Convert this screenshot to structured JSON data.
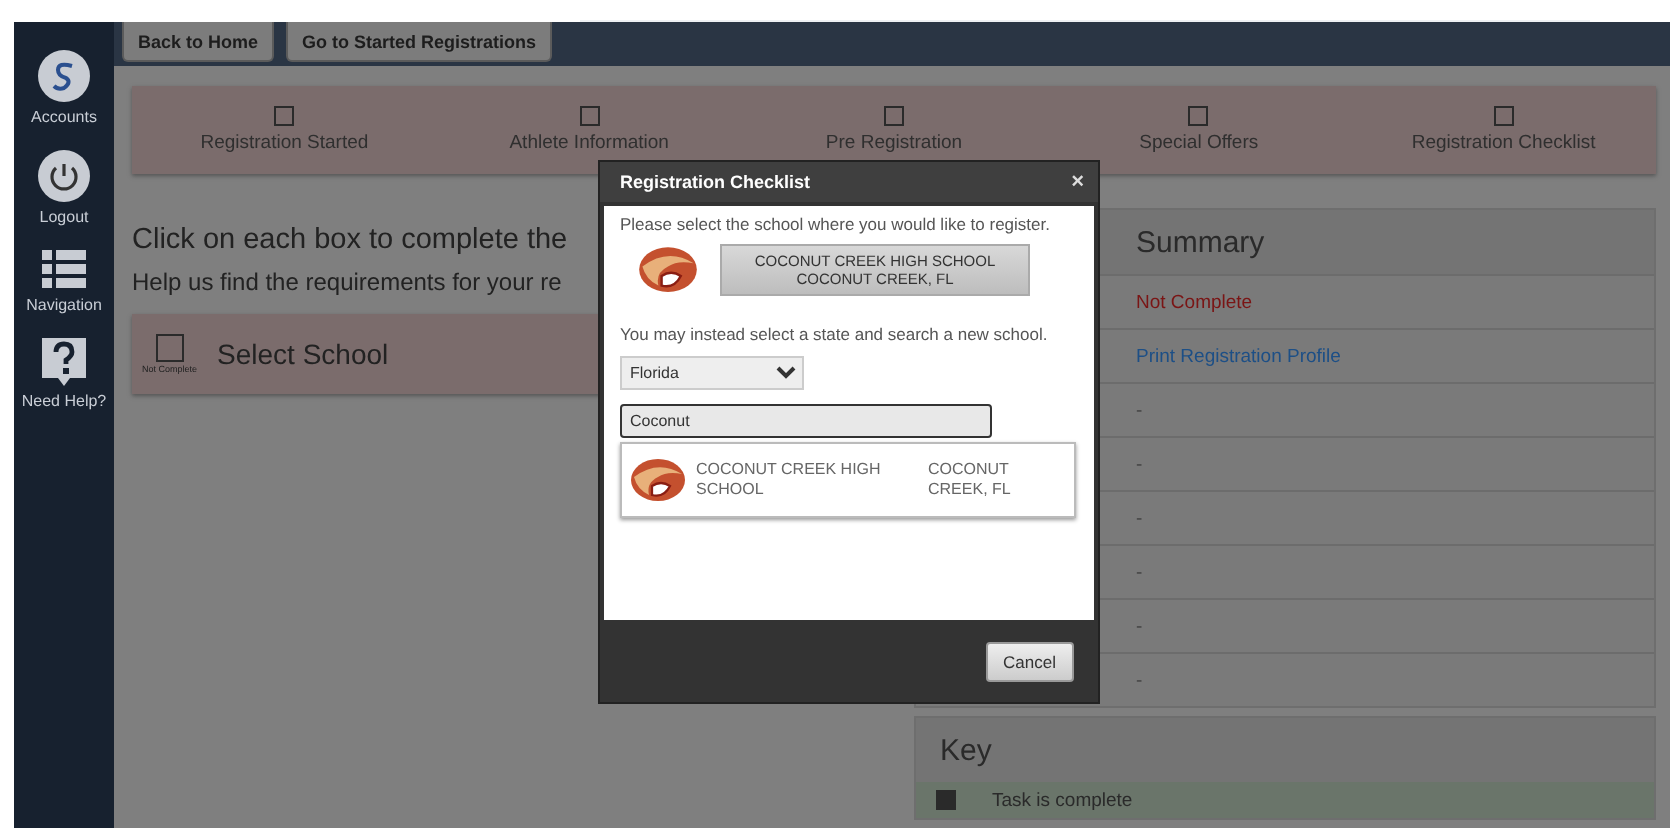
{
  "sidebar": {
    "items": [
      {
        "kind": "logo",
        "label": "Accounts"
      },
      {
        "kind": "power",
        "label": "Logout"
      },
      {
        "kind": "list",
        "label": "Navigation"
      },
      {
        "kind": "help",
        "label": "Need Help?"
      }
    ]
  },
  "top_bar": {
    "buttons": [
      "Back to Home",
      "Go to Started Registrations"
    ]
  },
  "steps": [
    {
      "label": "Registration Started",
      "checked": false
    },
    {
      "label": "Athlete Information",
      "checked": false
    },
    {
      "label": "Pre Registration",
      "checked": false
    },
    {
      "label": "Special Offers",
      "checked": false
    },
    {
      "label": "Registration Checklist",
      "checked": false
    }
  ],
  "intro": {
    "heading": "Click on each box to complete the",
    "subheading": "Help us find the requirements for your re"
  },
  "task_card": {
    "title": "Select School",
    "status": "Not Complete",
    "checked": false
  },
  "summary": {
    "title": "Summary",
    "rows": [
      {
        "kind": "status",
        "text": "Not Complete"
      },
      {
        "kind": "link",
        "text": "Print Registration Profile"
      },
      {
        "kind": "plain",
        "text": "-"
      },
      {
        "kind": "plain",
        "text": "-"
      },
      {
        "kind": "plain",
        "text": "-"
      },
      {
        "kind": "plain",
        "text": "-"
      },
      {
        "kind": "plain",
        "text": "-"
      },
      {
        "kind": "plain",
        "text": "-"
      }
    ]
  },
  "key": {
    "title": "Key",
    "rows": [
      {
        "text": "Task is complete",
        "checked": true
      }
    ]
  },
  "dialog": {
    "title": "Registration Checklist",
    "close": "×",
    "prompt": "Please select the school where you would like to register.",
    "current_school": {
      "name": "COCONUT CREEK HIGH SCHOOL",
      "location": "COCONUT CREEK, FL"
    },
    "alternative": "You may instead select a state and search a new school.",
    "state": "Florida",
    "search": "Coconut",
    "results": [
      {
        "name": "COCONUT CREEK HIGH SCHOOL",
        "location": "COCONUT CREEK, FL"
      }
    ],
    "cancel": "Cancel"
  }
}
